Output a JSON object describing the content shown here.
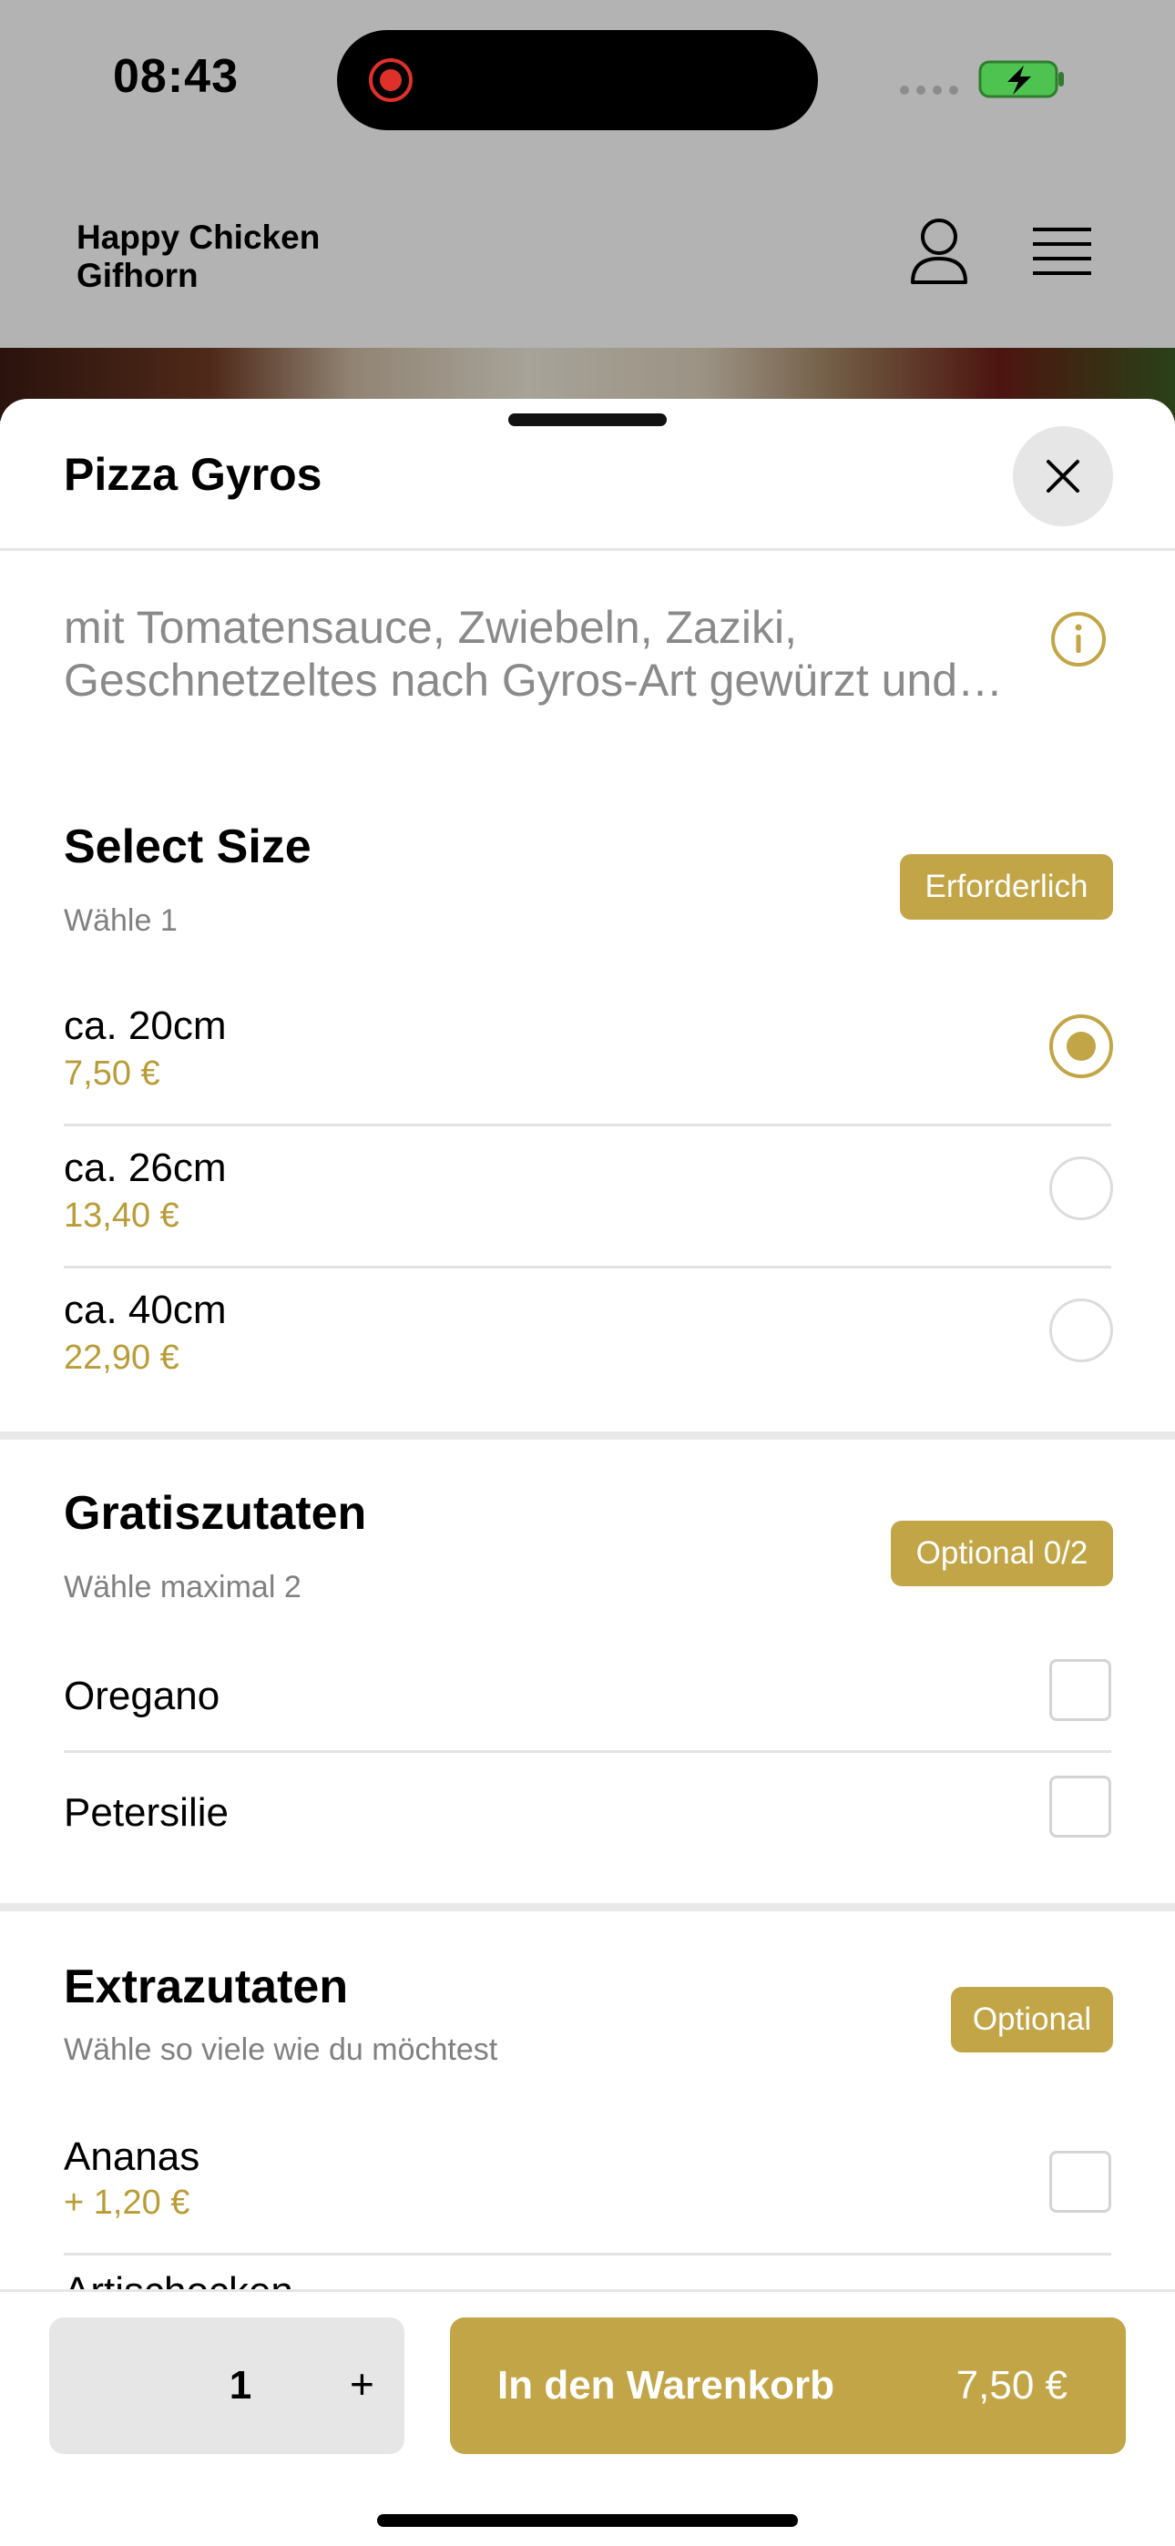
{
  "status_bar": {
    "time": "08:43"
  },
  "header": {
    "brand": "Happy Chicken\nGifhorn"
  },
  "product": {
    "title": "Pizza Gyros",
    "description": "mit Tomatensauce, Zwiebeln, Zaziki, Geschnetzeltes nach Gyros-Art gewürzt und…"
  },
  "size_section": {
    "title": "Select Size",
    "subtitle": "Wähle 1",
    "badge": "Erforderlich",
    "options": [
      {
        "name": "ca. 20cm",
        "price": "7,50 €",
        "selected": true
      },
      {
        "name": "ca. 26cm",
        "price": "13,40 €",
        "selected": false
      },
      {
        "name": "ca. 40cm",
        "price": "22,90 €",
        "selected": false
      }
    ]
  },
  "free_section": {
    "title": "Gratiszutaten",
    "subtitle": "Wähle maximal 2",
    "badge": "Optional 0/2",
    "options": [
      {
        "name": "Oregano",
        "checked": false
      },
      {
        "name": "Petersilie",
        "checked": false
      }
    ]
  },
  "extra_section": {
    "title": "Extrazutaten",
    "subtitle": "Wähle so viele wie du möchtest",
    "badge": "Optional",
    "options": [
      {
        "name": "Ananas",
        "price": "+ 1,20 €",
        "checked": false
      },
      {
        "name": "Artischocken",
        "checked": false
      }
    ]
  },
  "bottom_bar": {
    "quantity": "1",
    "plus_label": "+",
    "cart_label": "In den Warenkorb",
    "cart_price": "7,50 €"
  },
  "colors": {
    "accent": "#c2a546",
    "price_text": "#b99c38",
    "dim_background": "#b3b3b3"
  }
}
